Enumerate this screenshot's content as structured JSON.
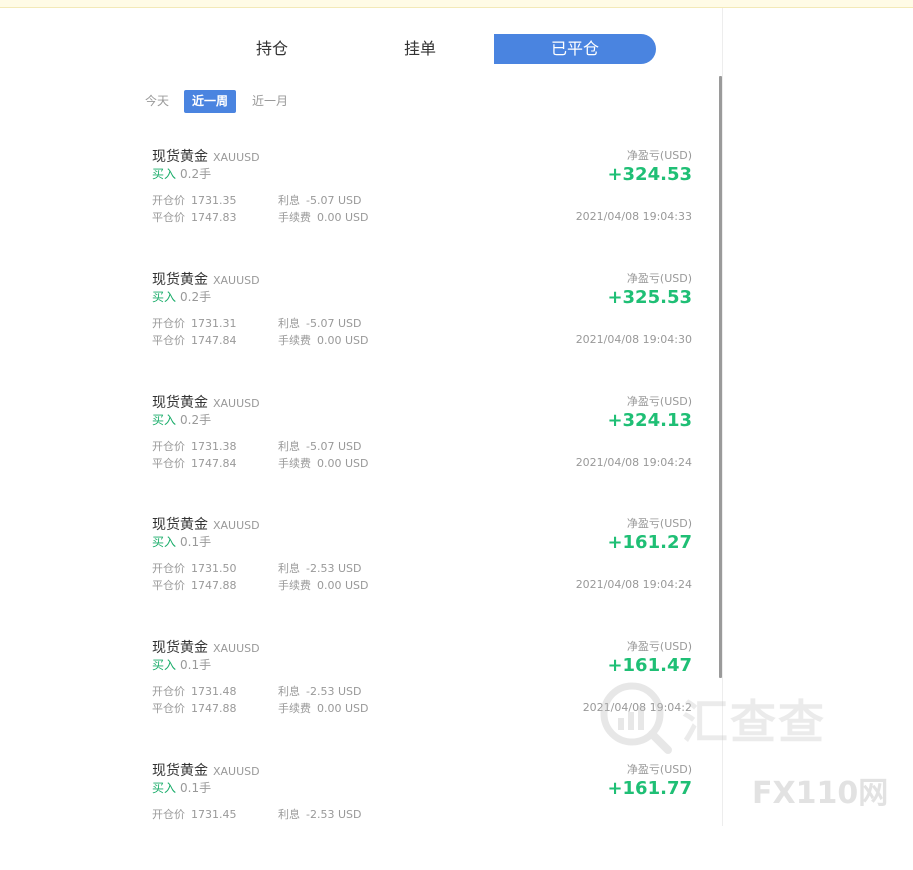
{
  "tabs": {
    "holding": "持仓",
    "pending": "挂单",
    "closed": "已平仓"
  },
  "filters": {
    "today": "今天",
    "week": "近一周",
    "month": "近一月"
  },
  "labels": {
    "open_price": "开仓价",
    "close_price": "平仓价",
    "interest": "利息",
    "fee": "手续费",
    "pnl": "净盈亏(USD)"
  },
  "colors": {
    "accent": "#4a84e0",
    "profit": "#1fbf75",
    "buy": "#1aad6a"
  },
  "trades": [
    {
      "name": "现货黄金",
      "code": "XAUUSD",
      "side": "买入",
      "lots": "0.2手",
      "open_price": "1731.35",
      "close_price": "1747.83",
      "interest": "-5.07 USD",
      "fee": "0.00 USD",
      "pnl": "+324.53",
      "time": "2021/04/08 19:04:33"
    },
    {
      "name": "现货黄金",
      "code": "XAUUSD",
      "side": "买入",
      "lots": "0.2手",
      "open_price": "1731.31",
      "close_price": "1747.84",
      "interest": "-5.07 USD",
      "fee": "0.00 USD",
      "pnl": "+325.53",
      "time": "2021/04/08 19:04:30"
    },
    {
      "name": "现货黄金",
      "code": "XAUUSD",
      "side": "买入",
      "lots": "0.2手",
      "open_price": "1731.38",
      "close_price": "1747.84",
      "interest": "-5.07 USD",
      "fee": "0.00 USD",
      "pnl": "+324.13",
      "time": "2021/04/08 19:04:24"
    },
    {
      "name": "现货黄金",
      "code": "XAUUSD",
      "side": "买入",
      "lots": "0.1手",
      "open_price": "1731.50",
      "close_price": "1747.88",
      "interest": "-2.53 USD",
      "fee": "0.00 USD",
      "pnl": "+161.27",
      "time": "2021/04/08 19:04:24"
    },
    {
      "name": "现货黄金",
      "code": "XAUUSD",
      "side": "买入",
      "lots": "0.1手",
      "open_price": "1731.48",
      "close_price": "1747.88",
      "interest": "-2.53 USD",
      "fee": "0.00 USD",
      "pnl": "+161.47",
      "time": "2021/04/08 19:04:2"
    },
    {
      "name": "现货黄金",
      "code": "XAUUSD",
      "side": "买入",
      "lots": "0.1手",
      "open_price": "1731.45",
      "close_price": "",
      "interest": "-2.53 USD",
      "fee": "",
      "pnl": "+161.77",
      "time": ""
    }
  ],
  "watermark": {
    "text": "汇查查",
    "badge": "FX110网"
  }
}
